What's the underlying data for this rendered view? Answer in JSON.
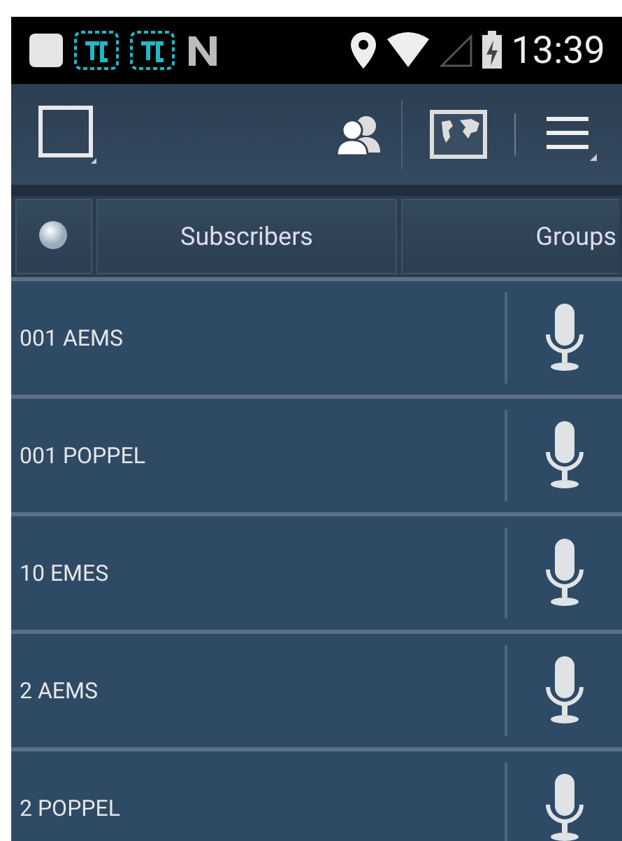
{
  "status_bar": {
    "time": "13:39"
  },
  "tabs": [
    {
      "label": "Subscribers"
    },
    {
      "label": "Groups"
    }
  ],
  "rows": [
    {
      "name": "001 AEMS"
    },
    {
      "name": "001 POPPEL"
    },
    {
      "name": "10 EMES"
    },
    {
      "name": "2 AEMS"
    },
    {
      "name": "2 POPPEL"
    }
  ]
}
